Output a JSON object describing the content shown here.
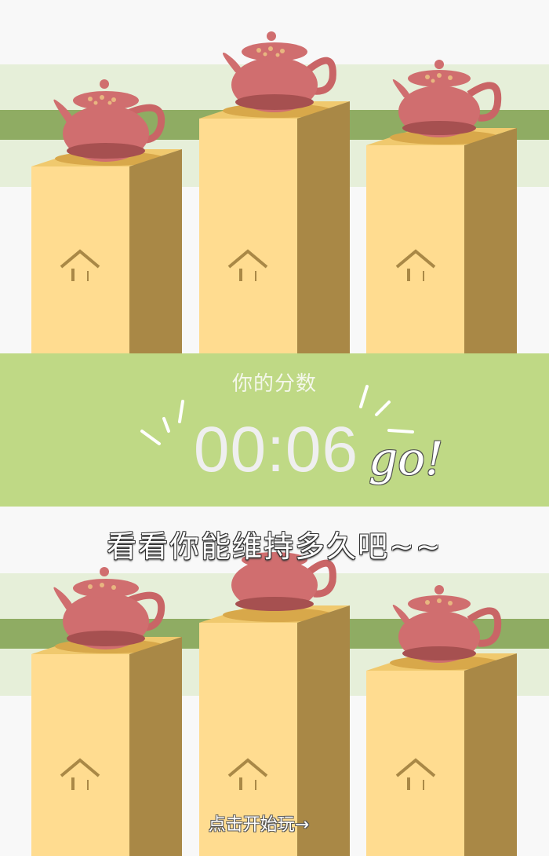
{
  "score_panel": {
    "label": "你的分数",
    "timer": "00:06",
    "go": "go!"
  },
  "tagline": "看看你能维持多久吧~~",
  "start_button": "点击开始玩→",
  "colors": {
    "panel_green": "#bfd985",
    "stripe_light": "#e6efd9",
    "stripe_dark": "#8fac63",
    "pillar_front": "#ffdc90",
    "pillar_side": "#a98846",
    "teapot": "#d06e6f",
    "tray": "#d8a84a"
  },
  "icons": [
    "teapot-icon",
    "house-arrow-icon"
  ]
}
